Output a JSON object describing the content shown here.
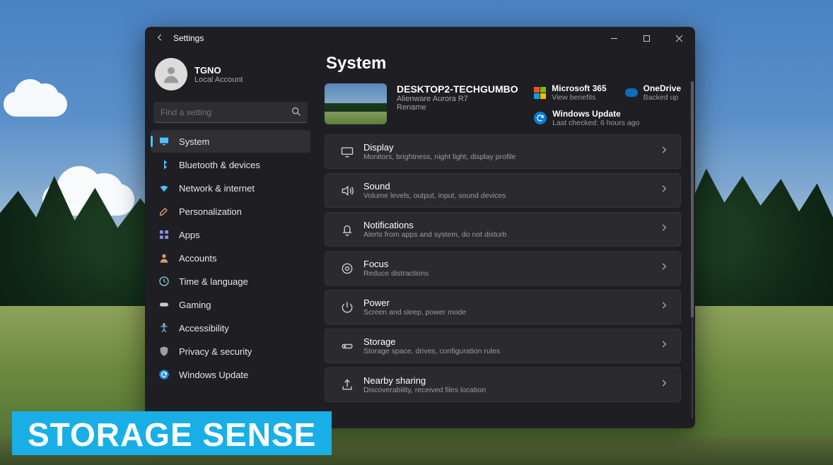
{
  "banner": {
    "text": "STORAGE SENSE"
  },
  "window": {
    "appname": "Settings",
    "account": {
      "name": "TGNO",
      "type": "Local Account"
    },
    "search": {
      "placeholder": "Find a setting"
    },
    "nav": [
      {
        "label": "System",
        "icon": "monitor",
        "active": true
      },
      {
        "label": "Bluetooth & devices",
        "icon": "bluetooth",
        "active": false
      },
      {
        "label": "Network & internet",
        "icon": "wifi",
        "active": false
      },
      {
        "label": "Personalization",
        "icon": "brush",
        "active": false
      },
      {
        "label": "Apps",
        "icon": "grid",
        "active": false
      },
      {
        "label": "Accounts",
        "icon": "person",
        "active": false
      },
      {
        "label": "Time & language",
        "icon": "clock",
        "active": false
      },
      {
        "label": "Gaming",
        "icon": "gamepad",
        "active": false
      },
      {
        "label": "Accessibility",
        "icon": "accessibility",
        "active": false
      },
      {
        "label": "Privacy & security",
        "icon": "shield",
        "active": false
      },
      {
        "label": "Windows Update",
        "icon": "update",
        "active": false
      }
    ],
    "page": {
      "title": "System",
      "device": {
        "name": "DESKTOP2-TECHGUMBO",
        "model": "Alienware Aurora R7",
        "rename": "Rename"
      },
      "tiles": {
        "ms365": {
          "title": "Microsoft 365",
          "sub": "View benefits"
        },
        "onedrive": {
          "title": "OneDrive",
          "sub": "Backed up"
        },
        "wu": {
          "title": "Windows Update",
          "sub": "Last checked: 6 hours ago"
        }
      },
      "cards": [
        {
          "icon": "monitor",
          "title": "Display",
          "sub": "Monitors, brightness, night light, display profile"
        },
        {
          "icon": "sound",
          "title": "Sound",
          "sub": "Volume levels, output, input, sound devices"
        },
        {
          "icon": "bell",
          "title": "Notifications",
          "sub": "Alerts from apps and system, do not disturb"
        },
        {
          "icon": "focus",
          "title": "Focus",
          "sub": "Reduce distractions"
        },
        {
          "icon": "power",
          "title": "Power",
          "sub": "Screen and sleep, power mode"
        },
        {
          "icon": "storage",
          "title": "Storage",
          "sub": "Storage space, drives, configuration rules"
        },
        {
          "icon": "share",
          "title": "Nearby sharing",
          "sub": "Discoverability, received files location"
        }
      ]
    }
  }
}
